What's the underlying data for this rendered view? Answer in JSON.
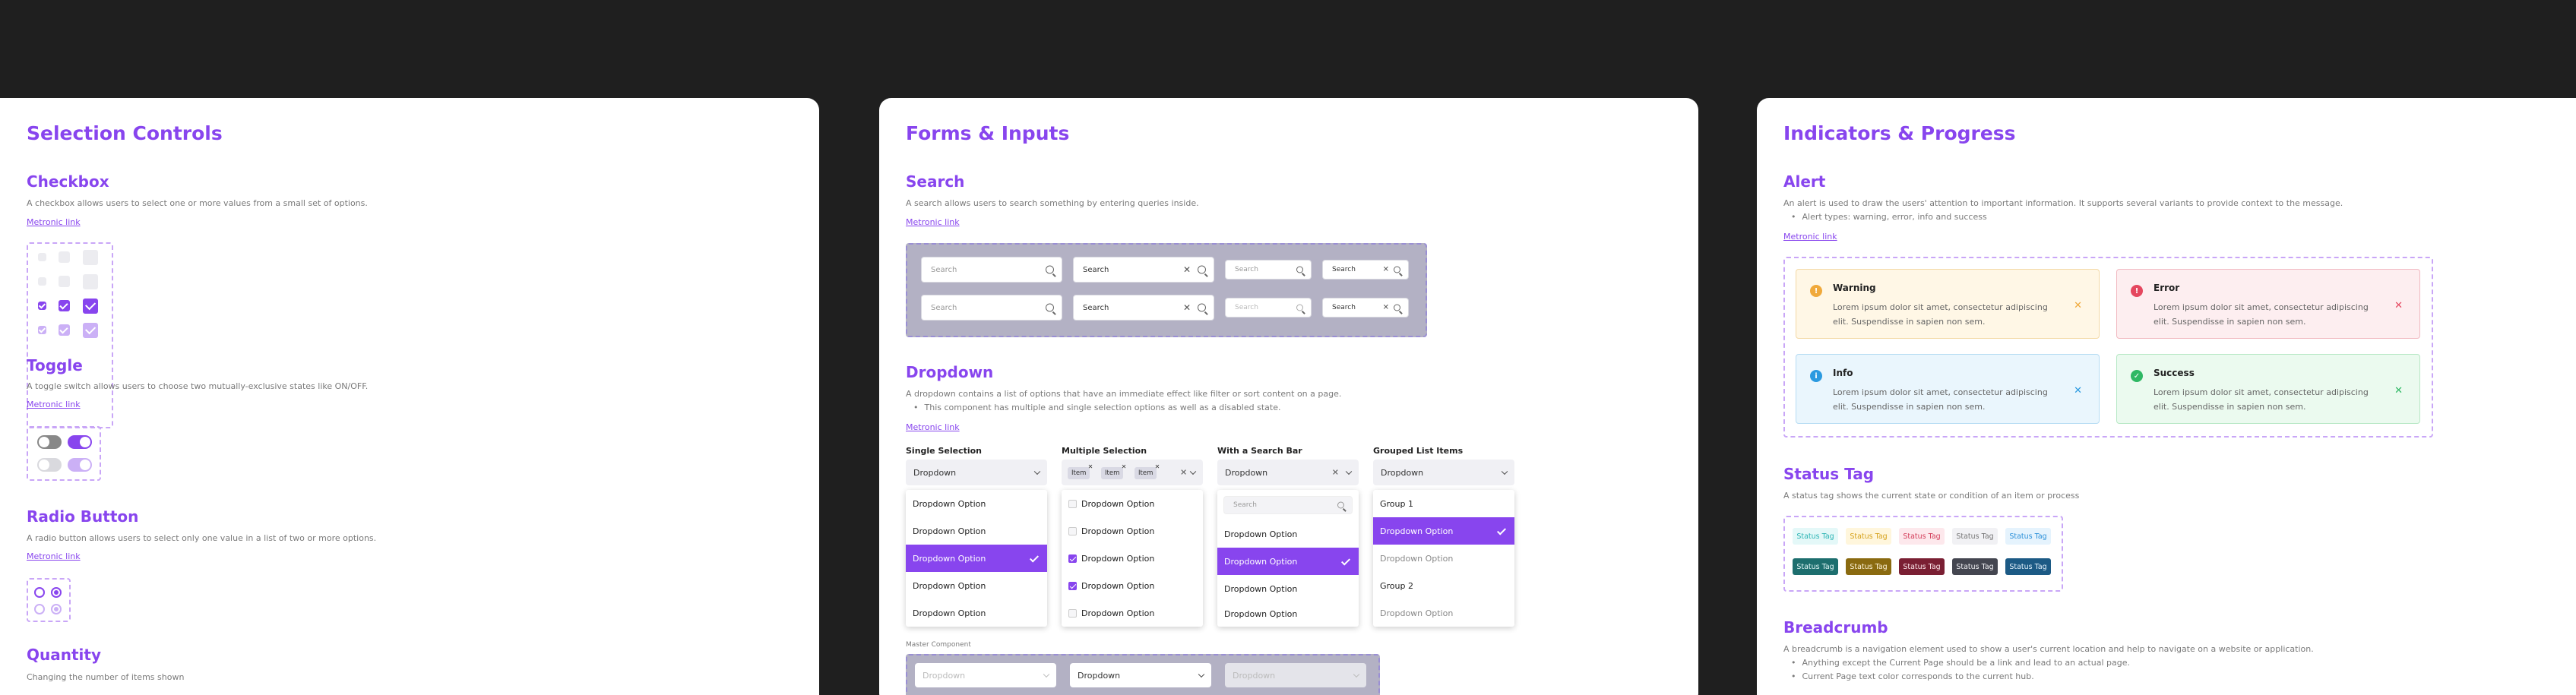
{
  "selection_controls": {
    "title": "Selection Controls",
    "checkbox": {
      "title": "Checkbox",
      "desc": "A checkbox allows users to select one or more values from a small set of options.",
      "link": "Metronic link"
    },
    "toggle": {
      "title": "Toggle",
      "desc": "A toggle switch allows users to choose two mutually-exclusive states like ON/OFF.",
      "link": "Metronic link"
    },
    "radio": {
      "title": "Radio Button",
      "desc": "A radio button allows users to select only one value in a list of two or more options.",
      "link": "Metronic link"
    },
    "quantity": {
      "title": "Quantity",
      "desc": "Changing the number of items shown"
    }
  },
  "forms_inputs": {
    "title": "Forms & Inputs",
    "search": {
      "title": "Search",
      "desc": "A search allows users to search something by entering queries inside.",
      "link": "Metronic link",
      "placeholder": "Search"
    },
    "dropdown": {
      "title": "Dropdown",
      "desc": "A dropdown contains a list of options that have an immediate effect like filter or sort content on a page.",
      "bullet": "This component has multiple and single selection options as well as a disabled state.",
      "link": "Metronic link",
      "single_label": "Single Selection",
      "multiple_label": "Multiple Selection",
      "search_label": "With a Search Bar",
      "grouped_label": "Grouped List Items",
      "head": "Dropdown",
      "option": "Dropdown Option",
      "chip": "Item",
      "search_placeholder": "Search",
      "group1": "Group 1",
      "group2": "Group 2",
      "master_label": "Master Component",
      "master_items": [
        "Dropdown",
        "Dropdown",
        "Dropdown"
      ]
    }
  },
  "indicators": {
    "title": "Indicators & Progress",
    "alert": {
      "title": "Alert",
      "desc": "An alert is used to draw the users' attention to important information. It supports several variants to provide context to the message.",
      "bullet": "Alert types: warning, error, info and success",
      "link": "Metronic link",
      "body": "Lorem ipsum dolor sit amet, consectetur adipiscing elit. Suspendisse in sapien non sem.",
      "items": [
        {
          "title": "Warning",
          "icon": "!",
          "bg": "#fff7e6",
          "border": "#f3d9a5",
          "color": "#f0a93b"
        },
        {
          "title": "Error",
          "icon": "!",
          "bg": "#fdeef0",
          "border": "#f1b9c1",
          "color": "#e5475f"
        },
        {
          "title": "Info",
          "icon": "i",
          "bg": "#eaf6fd",
          "border": "#b6dcf3",
          "color": "#2b9ae0"
        },
        {
          "title": "Success",
          "icon": "✓",
          "bg": "#ebfaef",
          "border": "#b7e8c5",
          "color": "#2fb864"
        }
      ]
    },
    "status_tag": {
      "title": "Status Tag",
      "desc": "A status tag shows the current state or condition of an item or process",
      "label": "Status Tag"
    },
    "breadcrumb": {
      "title": "Breadcrumb",
      "desc": "A breadcrumb is a navigation element used to show a user's current location and help to navigate on a website or application.",
      "bullets": [
        "Anything except the Current Page should be a link and lead to an actual page.",
        "Current Page text color corresponds to the current hub."
      ]
    }
  }
}
